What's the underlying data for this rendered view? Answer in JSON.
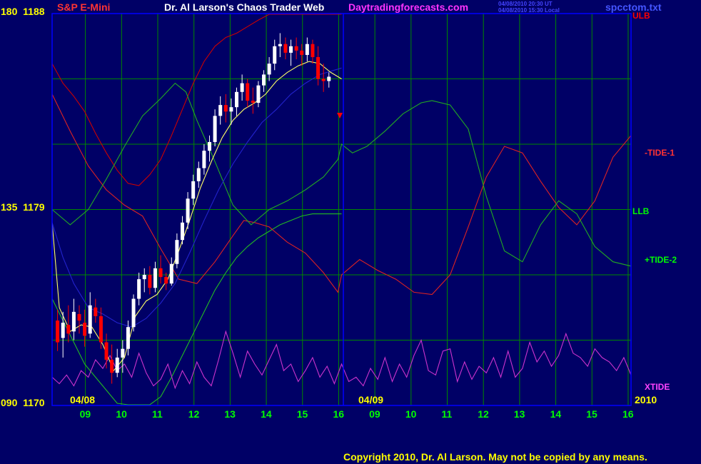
{
  "header": {
    "instrument": "S&P E-Mini",
    "title": "Dr. Al Larson's Chaos Trader Web",
    "site": "Daytradingforecasts.com",
    "timestamp_ut": "04/08/2010 20:30 UT",
    "timestamp_local": "04/08/2010 15:30 Local",
    "file": "spcctom.txt"
  },
  "footer": {
    "copyright": "Copyright 2010, Dr. Al Larson. May not be copied by any means."
  },
  "colors": {
    "background": "#000066",
    "frame": "#0000ff",
    "grid": "#008800",
    "axis_text": "#ffff00",
    "time_text": "#00ff00",
    "ulb": "#cc0000",
    "llb": "#22bb22",
    "tide1": "#dd2222",
    "tide2": "#22aa22",
    "xtide": "#cc33cc",
    "ma_blue": "#2222cc",
    "ma_yellow": "#ffff66",
    "price_up": "#ffffff",
    "price_down": "#ff0000"
  },
  "chart_data": {
    "type": "line",
    "y_axis": {
      "left_labels": [
        {
          "angle": "180",
          "price": "1188",
          "value": 1188
        },
        {
          "angle": "135",
          "price": "1179",
          "value": 1179
        },
        {
          "angle": "090",
          "price": "1170",
          "value": 1170
        }
      ],
      "ylim": [
        1170,
        1188
      ]
    },
    "x_axis": {
      "hour_ticks": [
        "09",
        "10",
        "11",
        "12",
        "13",
        "14",
        "15",
        "16",
        "09",
        "10",
        "11",
        "12",
        "13",
        "14",
        "15",
        "16"
      ],
      "date_labels": [
        "04/08",
        "04/09",
        "2010"
      ],
      "xlim": [
        0,
        16
      ]
    },
    "right_labels": [
      {
        "name": "ULB",
        "color": "#ff0000"
      },
      {
        "name": "-TIDE-1",
        "color": "#ff3333"
      },
      {
        "name": "LLB",
        "color": "#00ff00"
      },
      {
        "name": "+TIDE-2",
        "color": "#00ff00"
      },
      {
        "name": "XTIDE",
        "color": "#ff44ff"
      }
    ],
    "series": [
      {
        "key": "ulb",
        "x": [
          0,
          0.3,
          0.6,
          0.9,
          1.2,
          1.5,
          1.8,
          2.1,
          2.4,
          2.7,
          3.0,
          3.3,
          3.6,
          3.9,
          4.2,
          4.5,
          4.8,
          5.1,
          5.4,
          5.7,
          6.0,
          6.3,
          6.6,
          6.9,
          7.2,
          7.5,
          7.8,
          8.0
        ],
        "y": [
          1185.7,
          1184.8,
          1184.2,
          1183.5,
          1182.5,
          1181.6,
          1180.8,
          1180.2,
          1180.1,
          1180.6,
          1181.3,
          1182.4,
          1183.6,
          1184.8,
          1185.8,
          1186.5,
          1186.9,
          1187.1,
          1187.4,
          1187.7,
          1188.0,
          1188.3,
          1188.7,
          1189.0,
          1189.2,
          1189.3,
          1189.2,
          1189.2
        ]
      },
      {
        "key": "llb",
        "x": [
          0,
          0.3,
          0.6,
          0.9,
          1.2,
          1.5,
          1.8,
          2.1,
          2.4,
          2.7,
          3.0,
          3.3,
          3.6,
          3.9,
          4.2,
          4.5,
          4.8,
          5.1,
          5.4,
          5.7,
          6.0,
          6.3,
          6.6,
          6.9,
          7.2,
          7.5,
          7.8,
          8.0
        ],
        "y": [
          1174.9,
          1173.9,
          1172.9,
          1171.9,
          1171.3,
          1170.7,
          1170.1,
          1169.6,
          1169.4,
          1169.7,
          1170.4,
          1171.3,
          1172.3,
          1173.3,
          1174.3,
          1175.3,
          1176.1,
          1176.8,
          1177.3,
          1177.7,
          1178.0,
          1178.3,
          1178.5,
          1178.7,
          1178.8,
          1178.8,
          1178.8,
          1178.8
        ]
      },
      {
        "key": "tide1",
        "x": [
          0,
          0.5,
          1.0,
          1.5,
          2.0,
          2.5,
          3.0,
          3.5,
          4.0,
          4.5,
          5.0,
          5.3,
          5.6,
          6.0,
          6.5,
          7.0,
          7.5,
          7.9,
          8.0,
          8.5,
          9.0,
          9.5,
          10.0,
          10.5,
          11.0,
          11.5,
          12.0,
          12.5,
          13.0,
          13.5,
          14.0,
          14.5,
          15.0,
          15.5,
          16.0
        ],
        "y": [
          1184.3,
          1182.6,
          1181.0,
          1179.9,
          1179.2,
          1178.7,
          1177.2,
          1175.8,
          1175.6,
          1176.6,
          1177.8,
          1178.5,
          1178.4,
          1178.2,
          1177.5,
          1177.0,
          1176.1,
          1175.2,
          1176.0,
          1176.7,
          1176.2,
          1175.8,
          1175.2,
          1175.1,
          1176.0,
          1178.2,
          1180.5,
          1181.9,
          1181.6,
          1180.3,
          1179.1,
          1178.3,
          1179.4,
          1181.4,
          1182.4
        ]
      },
      {
        "key": "tide2",
        "x": [
          0,
          0.5,
          1.0,
          1.5,
          2.0,
          2.5,
          3.0,
          3.4,
          3.7,
          4.0,
          4.5,
          5.0,
          5.5,
          6.0,
          6.5,
          7.0,
          7.5,
          7.9,
          8.0,
          8.3,
          8.7,
          9.2,
          9.7,
          10.2,
          10.5,
          11.0,
          11.5,
          12.0,
          12.5,
          13.0,
          13.5,
          14.0,
          14.5,
          15.0,
          15.5,
          16.0
        ],
        "y": [
          1179.0,
          1178.3,
          1179.0,
          1180.4,
          1181.9,
          1183.3,
          1184.1,
          1184.8,
          1184.4,
          1183.1,
          1181.2,
          1179.2,
          1178.3,
          1179.0,
          1179.4,
          1179.9,
          1180.5,
          1181.3,
          1182.0,
          1181.6,
          1181.9,
          1182.6,
          1183.4,
          1183.9,
          1184.0,
          1183.8,
          1182.7,
          1179.6,
          1177.1,
          1176.6,
          1178.3,
          1179.4,
          1178.8,
          1177.3,
          1176.6,
          1176.4
        ]
      },
      {
        "key": "xtide",
        "x": [
          0,
          0.2,
          0.4,
          0.6,
          0.8,
          1.0,
          1.2,
          1.4,
          1.6,
          1.8,
          2.0,
          2.2,
          2.4,
          2.6,
          2.8,
          3.0,
          3.2,
          3.4,
          3.6,
          3.8,
          4.0,
          4.2,
          4.4,
          4.6,
          4.8,
          5.0,
          5.2,
          5.4,
          5.6,
          5.8,
          6.0,
          6.2,
          6.4,
          6.6,
          6.8,
          7.0,
          7.2,
          7.4,
          7.6,
          7.8,
          8.0,
          8.2,
          8.4,
          8.6,
          8.8,
          9.0,
          9.2,
          9.4,
          9.6,
          9.8,
          10.0,
          10.2,
          10.4,
          10.6,
          10.8,
          11.0,
          11.2,
          11.4,
          11.6,
          11.8,
          12.0,
          12.2,
          12.4,
          12.6,
          12.8,
          13.0,
          13.2,
          13.4,
          13.6,
          13.8,
          14.0,
          14.2,
          14.4,
          14.6,
          14.8,
          15.0,
          15.2,
          15.4,
          15.6,
          15.8,
          16.0
        ],
        "y": [
          1171.3,
          1171.0,
          1171.4,
          1170.9,
          1171.6,
          1171.3,
          1172.1,
          1171.7,
          1172.3,
          1171.6,
          1171.9,
          1171.3,
          1172.4,
          1171.5,
          1170.9,
          1171.2,
          1171.9,
          1170.8,
          1171.6,
          1171.0,
          1172.0,
          1171.3,
          1170.9,
          1172.1,
          1173.4,
          1172.4,
          1171.3,
          1172.5,
          1171.9,
          1171.4,
          1172.1,
          1172.8,
          1171.6,
          1171.9,
          1171.1,
          1171.6,
          1172.2,
          1171.3,
          1171.8,
          1171.0,
          1171.9,
          1171.1,
          1171.3,
          1170.9,
          1171.7,
          1171.2,
          1172.2,
          1171.1,
          1171.9,
          1171.3,
          1172.3,
          1173.0,
          1171.6,
          1171.4,
          1172.5,
          1172.6,
          1171.1,
          1172.0,
          1171.2,
          1171.8,
          1171.5,
          1172.2,
          1171.3,
          1172.5,
          1171.3,
          1171.7,
          1172.9,
          1172.0,
          1172.5,
          1171.8,
          1172.3,
          1173.3,
          1172.4,
          1172.2,
          1171.8,
          1172.6,
          1172.2,
          1172.0,
          1171.6,
          1172.2,
          1171.4
        ]
      },
      {
        "key": "ma_blue",
        "x": [
          0,
          0.3,
          0.6,
          1.0,
          1.4,
          1.8,
          2.2,
          2.6,
          3.0,
          3.4,
          3.8,
          4.2,
          4.6,
          5.0,
          5.4,
          5.8,
          6.2,
          6.6,
          7.0,
          7.4,
          7.8,
          8.0
        ],
        "y": [
          1178.4,
          1176.8,
          1175.6,
          1174.5,
          1174.2,
          1173.8,
          1173.6,
          1174.0,
          1174.7,
          1175.6,
          1177.0,
          1178.5,
          1179.9,
          1181.1,
          1182.1,
          1183.0,
          1183.6,
          1184.3,
          1184.8,
          1185.2,
          1185.4,
          1185.5
        ]
      },
      {
        "key": "ma_yellow",
        "x": [
          0,
          0.2,
          0.5,
          0.8,
          1.1,
          1.4,
          1.7,
          2.0,
          2.3,
          2.6,
          2.9,
          3.2,
          3.5,
          3.8,
          4.1,
          4.4,
          4.7,
          5.0,
          5.3,
          5.6,
          5.9,
          6.2,
          6.5,
          6.8,
          7.1,
          7.4,
          7.7,
          8.0
        ],
        "y": [
          1178.4,
          1174.5,
          1173.4,
          1173.7,
          1173.6,
          1172.8,
          1171.6,
          1172.2,
          1174.1,
          1174.8,
          1175.1,
          1175.8,
          1177.1,
          1178.5,
          1180.0,
          1181.2,
          1182.3,
          1183.1,
          1183.6,
          1183.9,
          1184.3,
          1184.9,
          1185.3,
          1185.6,
          1185.8,
          1185.7,
          1185.3,
          1185.0
        ]
      }
    ],
    "price_bars": [
      {
        "x": 0.15,
        "o": 1173.9,
        "h": 1174.4,
        "l": 1172.5,
        "c": 1172.9
      },
      {
        "x": 0.3,
        "o": 1173.1,
        "h": 1174.3,
        "l": 1172.2,
        "c": 1173.8
      },
      {
        "x": 0.45,
        "o": 1173.7,
        "h": 1174.6,
        "l": 1172.9,
        "c": 1173.3
      },
      {
        "x": 0.6,
        "o": 1173.4,
        "h": 1174.9,
        "l": 1173.0,
        "c": 1174.3
      },
      {
        "x": 0.75,
        "o": 1174.2,
        "h": 1174.6,
        "l": 1173.3,
        "c": 1173.9
      },
      {
        "x": 0.9,
        "o": 1173.8,
        "h": 1174.4,
        "l": 1172.7,
        "c": 1173.2
      },
      {
        "x": 1.05,
        "o": 1173.3,
        "h": 1175.2,
        "l": 1173.1,
        "c": 1174.6
      },
      {
        "x": 1.2,
        "o": 1174.5,
        "h": 1174.9,
        "l": 1173.8,
        "c": 1174.1
      },
      {
        "x": 1.35,
        "o": 1174.1,
        "h": 1174.5,
        "l": 1172.6,
        "c": 1172.9
      },
      {
        "x": 1.5,
        "o": 1172.9,
        "h": 1173.3,
        "l": 1171.7,
        "c": 1172.1
      },
      {
        "x": 1.65,
        "o": 1172.1,
        "h": 1172.8,
        "l": 1171.0,
        "c": 1171.5
      },
      {
        "x": 1.8,
        "o": 1171.5,
        "h": 1172.6,
        "l": 1171.3,
        "c": 1172.2
      },
      {
        "x": 1.95,
        "o": 1172.2,
        "h": 1173.0,
        "l": 1171.5,
        "c": 1172.6
      },
      {
        "x": 2.1,
        "o": 1172.6,
        "h": 1173.9,
        "l": 1172.3,
        "c": 1173.6
      },
      {
        "x": 2.25,
        "o": 1173.6,
        "h": 1175.1,
        "l": 1173.4,
        "c": 1174.9
      },
      {
        "x": 2.4,
        "o": 1174.9,
        "h": 1176.1,
        "l": 1174.6,
        "c": 1175.8
      },
      {
        "x": 2.55,
        "o": 1175.8,
        "h": 1176.3,
        "l": 1175.2,
        "c": 1176.0
      },
      {
        "x": 2.7,
        "o": 1176.0,
        "h": 1176.4,
        "l": 1175.1,
        "c": 1175.4
      },
      {
        "x": 2.85,
        "o": 1175.4,
        "h": 1176.6,
        "l": 1175.2,
        "c": 1176.3
      },
      {
        "x": 3.0,
        "o": 1176.3,
        "h": 1176.9,
        "l": 1175.6,
        "c": 1175.9
      },
      {
        "x": 3.15,
        "o": 1175.9,
        "h": 1176.1,
        "l": 1175.3,
        "c": 1175.6
      },
      {
        "x": 3.3,
        "o": 1175.6,
        "h": 1176.8,
        "l": 1175.5,
        "c": 1176.5
      },
      {
        "x": 3.45,
        "o": 1176.5,
        "h": 1177.9,
        "l": 1176.3,
        "c": 1177.6
      },
      {
        "x": 3.6,
        "o": 1177.6,
        "h": 1178.7,
        "l": 1177.4,
        "c": 1178.4
      },
      {
        "x": 3.75,
        "o": 1178.4,
        "h": 1179.8,
        "l": 1178.1,
        "c": 1179.5
      },
      {
        "x": 3.9,
        "o": 1179.5,
        "h": 1180.6,
        "l": 1179.2,
        "c": 1180.3
      },
      {
        "x": 4.05,
        "o": 1180.3,
        "h": 1181.2,
        "l": 1180.0,
        "c": 1180.9
      },
      {
        "x": 4.2,
        "o": 1180.9,
        "h": 1182.0,
        "l": 1180.6,
        "c": 1181.7
      },
      {
        "x": 4.35,
        "o": 1181.7,
        "h": 1182.4,
        "l": 1181.2,
        "c": 1182.1
      },
      {
        "x": 4.5,
        "o": 1182.1,
        "h": 1183.6,
        "l": 1181.9,
        "c": 1183.3
      },
      {
        "x": 4.65,
        "o": 1183.3,
        "h": 1184.2,
        "l": 1182.9,
        "c": 1183.8
      },
      {
        "x": 4.8,
        "o": 1183.8,
        "h": 1184.3,
        "l": 1183.0,
        "c": 1183.5
      },
      {
        "x": 4.95,
        "o": 1183.5,
        "h": 1184.1,
        "l": 1182.9,
        "c": 1183.7
      },
      {
        "x": 5.1,
        "o": 1183.7,
        "h": 1184.6,
        "l": 1183.3,
        "c": 1184.4
      },
      {
        "x": 5.25,
        "o": 1184.4,
        "h": 1185.2,
        "l": 1184.0,
        "c": 1184.8
      },
      {
        "x": 5.4,
        "o": 1184.8,
        "h": 1185.0,
        "l": 1183.7,
        "c": 1184.0
      },
      {
        "x": 5.55,
        "o": 1184.0,
        "h": 1184.6,
        "l": 1183.4,
        "c": 1183.9
      },
      {
        "x": 5.7,
        "o": 1183.9,
        "h": 1184.9,
        "l": 1183.7,
        "c": 1184.7
      },
      {
        "x": 5.85,
        "o": 1184.7,
        "h": 1185.4,
        "l": 1184.4,
        "c": 1185.2
      },
      {
        "x": 6.0,
        "o": 1185.2,
        "h": 1186.0,
        "l": 1184.9,
        "c": 1185.7
      },
      {
        "x": 6.15,
        "o": 1185.7,
        "h": 1186.8,
        "l": 1185.4,
        "c": 1186.5
      },
      {
        "x": 6.3,
        "o": 1186.5,
        "h": 1187.1,
        "l": 1186.0,
        "c": 1186.6
      },
      {
        "x": 6.45,
        "o": 1186.6,
        "h": 1186.9,
        "l": 1185.9,
        "c": 1186.2
      },
      {
        "x": 6.6,
        "o": 1186.2,
        "h": 1186.8,
        "l": 1185.6,
        "c": 1186.5
      },
      {
        "x": 6.75,
        "o": 1186.5,
        "h": 1186.9,
        "l": 1185.9,
        "c": 1186.3
      },
      {
        "x": 6.9,
        "o": 1186.3,
        "h": 1186.6,
        "l": 1185.6,
        "c": 1186.1
      },
      {
        "x": 7.05,
        "o": 1186.1,
        "h": 1186.9,
        "l": 1185.8,
        "c": 1186.6
      },
      {
        "x": 7.2,
        "o": 1186.6,
        "h": 1186.8,
        "l": 1185.7,
        "c": 1186.0
      },
      {
        "x": 7.35,
        "o": 1186.0,
        "h": 1186.5,
        "l": 1184.7,
        "c": 1185.0
      },
      {
        "x": 7.5,
        "o": 1185.0,
        "h": 1185.7,
        "l": 1184.4,
        "c": 1184.9
      },
      {
        "x": 7.65,
        "o": 1184.9,
        "h": 1185.3,
        "l": 1184.6,
        "c": 1185.1
      }
    ]
  }
}
